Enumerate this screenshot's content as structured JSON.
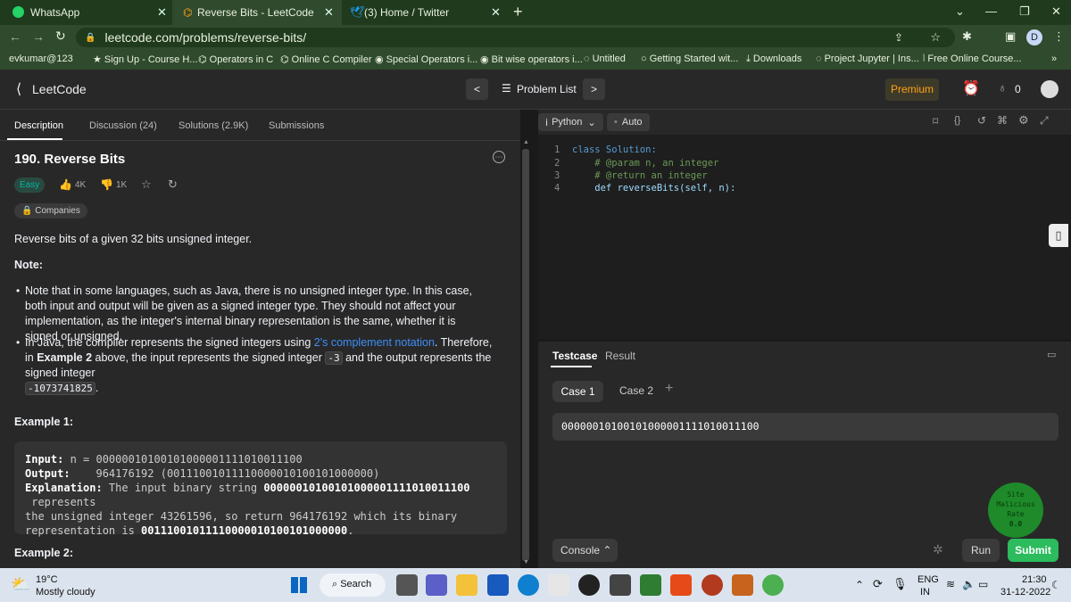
{
  "browser": {
    "tabs": [
      {
        "label": "WhatsApp",
        "active": false
      },
      {
        "label": "Reverse Bits - LeetCode",
        "active": true
      },
      {
        "label": "(3) Home / Twitter",
        "active": false
      }
    ],
    "url": "leetcode.com/problems/reverse-bits/",
    "bookmarks": [
      "evkumar@123",
      "Sign Up - Course H...",
      "Operators in C",
      "Online C Compiler",
      "Special Operators i...",
      "Bit wise operators i...",
      "Untitled",
      "Getting Started wit...",
      "Downloads",
      "Project Jupyter | Ins...",
      "Free Online Course..."
    ],
    "profile_letter": "D"
  },
  "lc": {
    "logo": "LeetCode",
    "problem_list": "Problem List",
    "premium": "Premium",
    "streak": "0"
  },
  "left": {
    "tabs": [
      "Description",
      "Discussion (24)",
      "Solutions (2.9K)",
      "Submissions"
    ],
    "title": "190. Reverse Bits",
    "difficulty": "Easy",
    "likes": "4K",
    "dislikes": "1K",
    "companies": "Companies",
    "intro": "Reverse bits of a given 32 bits unsigned integer.",
    "note_heading": "Note:",
    "bullet1": "Note that in some languages, such as Java, there is no unsigned integer type. In this case, both input and output will be given as a signed integer type. They should not affect your implementation, as the integer's internal binary representation is the same, whether it is signed or unsigned.",
    "bullet2_a": "In Java, the compiler represents the signed integers using ",
    "bullet2_link": "2's complement notation",
    "bullet2_b": ". Therefore, in ",
    "bullet2_bold": "Example 2",
    "bullet2_c": " above, the input represents the signed integer ",
    "bullet2_code1": "-3",
    "bullet2_d": " and the output represents the signed integer",
    "bullet2_code2": "-1073741825",
    "bullet2_e": ".",
    "example1_heading": "Example 1:",
    "ex1_input_label": "Input:",
    "ex1_input": " n = 00000010100101000001111010011100",
    "ex1_output_label": "Output:",
    "ex1_output": "    964176192 (00111001011110000010100101000000)",
    "ex1_expl_label": "Explanation:",
    "ex1_expl_a": " The input binary string ",
    "ex1_expl_bin": "00000010100101000001111010011100",
    "ex1_expl_b": " represents",
    "ex1_expl_line2": "the unsigned integer 43261596, so return 964176192 which its binary",
    "ex1_expl_line3a": "representation is ",
    "ex1_expl_bin2": "00111001011110000010100101000000",
    "ex1_expl_line3b": ".",
    "example2_heading": "Example 2:"
  },
  "editor": {
    "language": "Python",
    "auto": "Auto",
    "lines": [
      {
        "n": "1",
        "text": "class Solution:"
      },
      {
        "n": "2",
        "text": "    # @param n, an integer"
      },
      {
        "n": "3",
        "text": "    # @return an integer"
      },
      {
        "n": "4",
        "text": "    def reverseBits(self, n):"
      }
    ]
  },
  "testpanel": {
    "tab_testcase": "Testcase",
    "tab_result": "Result",
    "case1": "Case 1",
    "case2": "Case 2",
    "input_value": "00000010100101000001111010011100",
    "console": "Console",
    "run": "Run",
    "submit": "Submit",
    "malicious_line1": "Site",
    "malicious_line2": "Malicious",
    "malicious_line3": "Rate",
    "malicious_value": "0.0"
  },
  "taskbar": {
    "weather_temp": "19°C",
    "weather_desc": "Mostly cloudy",
    "search": "Search",
    "lang1": "ENG",
    "lang2": "IN",
    "time": "21:30",
    "date": "31-12-2022"
  }
}
